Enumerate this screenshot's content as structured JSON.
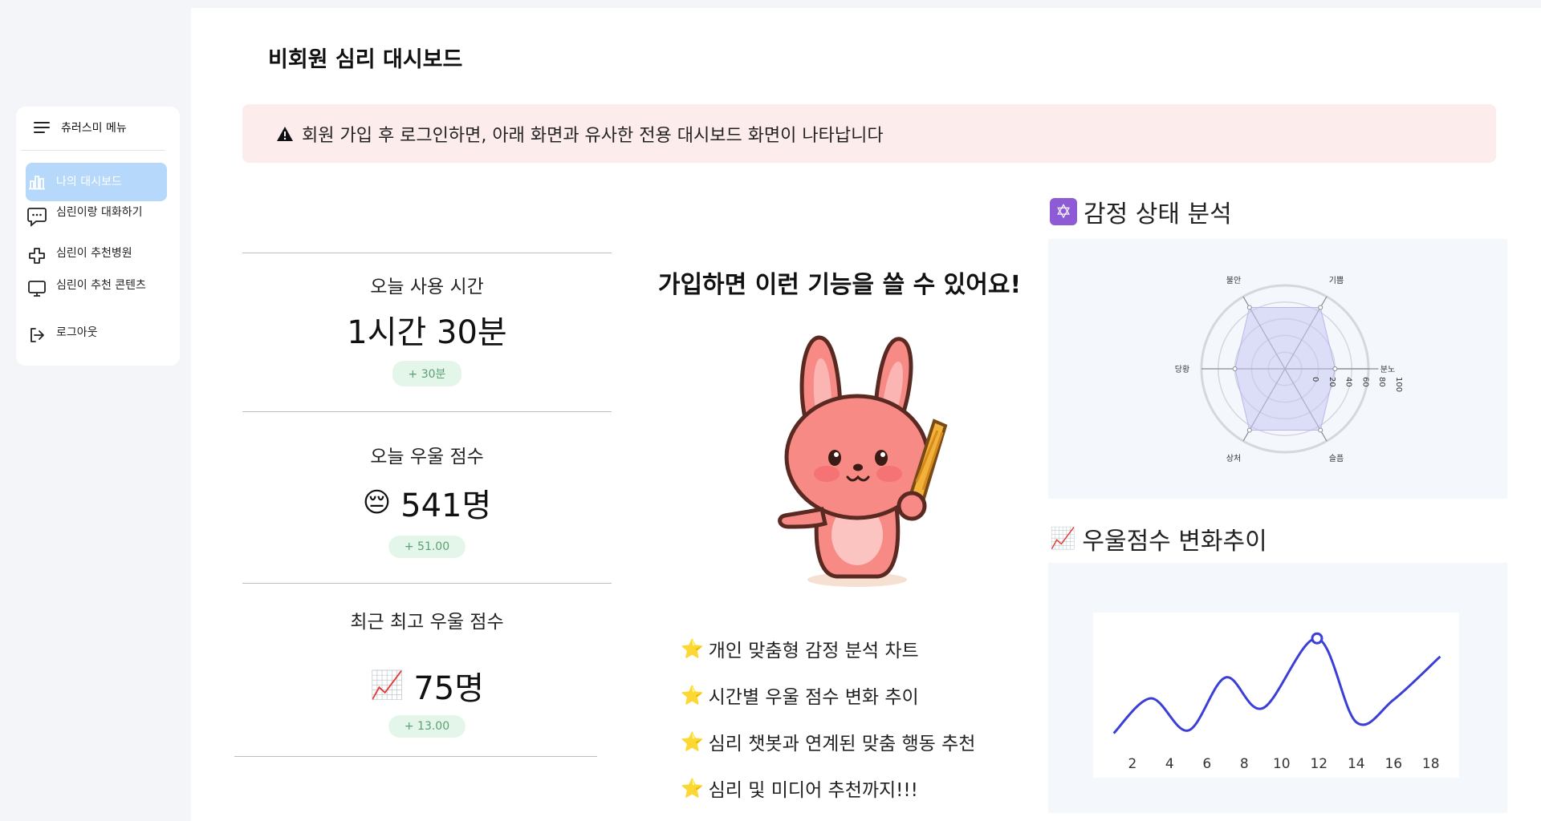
{
  "sidebar": {
    "menu_title": "츄러스미 메뉴",
    "items": [
      {
        "label": "나의 대시보드",
        "icon": "bar-chart-icon",
        "active": true
      },
      {
        "label": "심린이랑 대화하기",
        "icon": "chat-bubble-icon",
        "active": false
      },
      {
        "label": "심린이 추천병원",
        "icon": "medical-cross-icon",
        "active": false
      },
      {
        "label": "심린이 추천 콘텐츠",
        "icon": "monitor-icon",
        "active": false
      },
      {
        "label": "로그아웃",
        "icon": "logout-icon",
        "active": false
      }
    ]
  },
  "page_title": "비회원 심리 대시보드",
  "alert": {
    "icon": "warning-icon",
    "text": "회원 가입 후 로그인하면, 아래 화면과 유사한 전용 대시보드 화면이 나타납니다"
  },
  "metrics": [
    {
      "label": "오늘 사용 시간",
      "emoji": "",
      "value": "1시간 30분",
      "delta": "+ 30분"
    },
    {
      "label": "오늘 우울 점수",
      "emoji": "😔",
      "value": "541명",
      "delta": "+ 51.00"
    },
    {
      "label": "최근 최고 우울 점수",
      "emoji": "📈",
      "value": "75명",
      "delta": "+ 13.00"
    }
  ],
  "promo": {
    "title": "가입하면 이런 기능을 쓸 수 있어요!",
    "features": [
      "개인 맞춤형 감정 분석 차트",
      "시간별 우울 점수 변화 추이",
      "심리 챗봇과 연계된 맞춤 행동 추천",
      "심리 및 미디어 추천까지!!!"
    ]
  },
  "emotion_section": {
    "icon": "star-of-david-emoji",
    "title": "감정 상태 분석"
  },
  "trend_section": {
    "icon": "chart-increasing-emoji",
    "title": "우울점수 변화추이"
  },
  "colors": {
    "accent": "#3b3fd6",
    "active_nav": "#b6d8fa",
    "alert_bg": "#fdecec",
    "delta_bg": "#e4f6ea",
    "radar_fill": "#c9c7f3"
  },
  "chart_data": [
    {
      "type": "radar",
      "categories": [
        "기쁨",
        "분노",
        "슬픔",
        "상처",
        "당황",
        "불안"
      ],
      "values": [
        85,
        60,
        85,
        85,
        60,
        85
      ],
      "radial_ticks": [
        0,
        20,
        40,
        60,
        80,
        100
      ],
      "range": [
        0,
        100
      ]
    },
    {
      "type": "line",
      "x_ticks": [
        2,
        4,
        6,
        8,
        10,
        12,
        14,
        16,
        18
      ],
      "x": [
        1,
        3,
        5,
        7,
        9,
        11.9,
        14,
        16,
        18.5
      ],
      "y": [
        30,
        55,
        32,
        70,
        48,
        98,
        38,
        54,
        85
      ],
      "highlight_index": 5,
      "xlim": [
        0.5,
        19
      ],
      "ylim": [
        20,
        105
      ]
    }
  ]
}
